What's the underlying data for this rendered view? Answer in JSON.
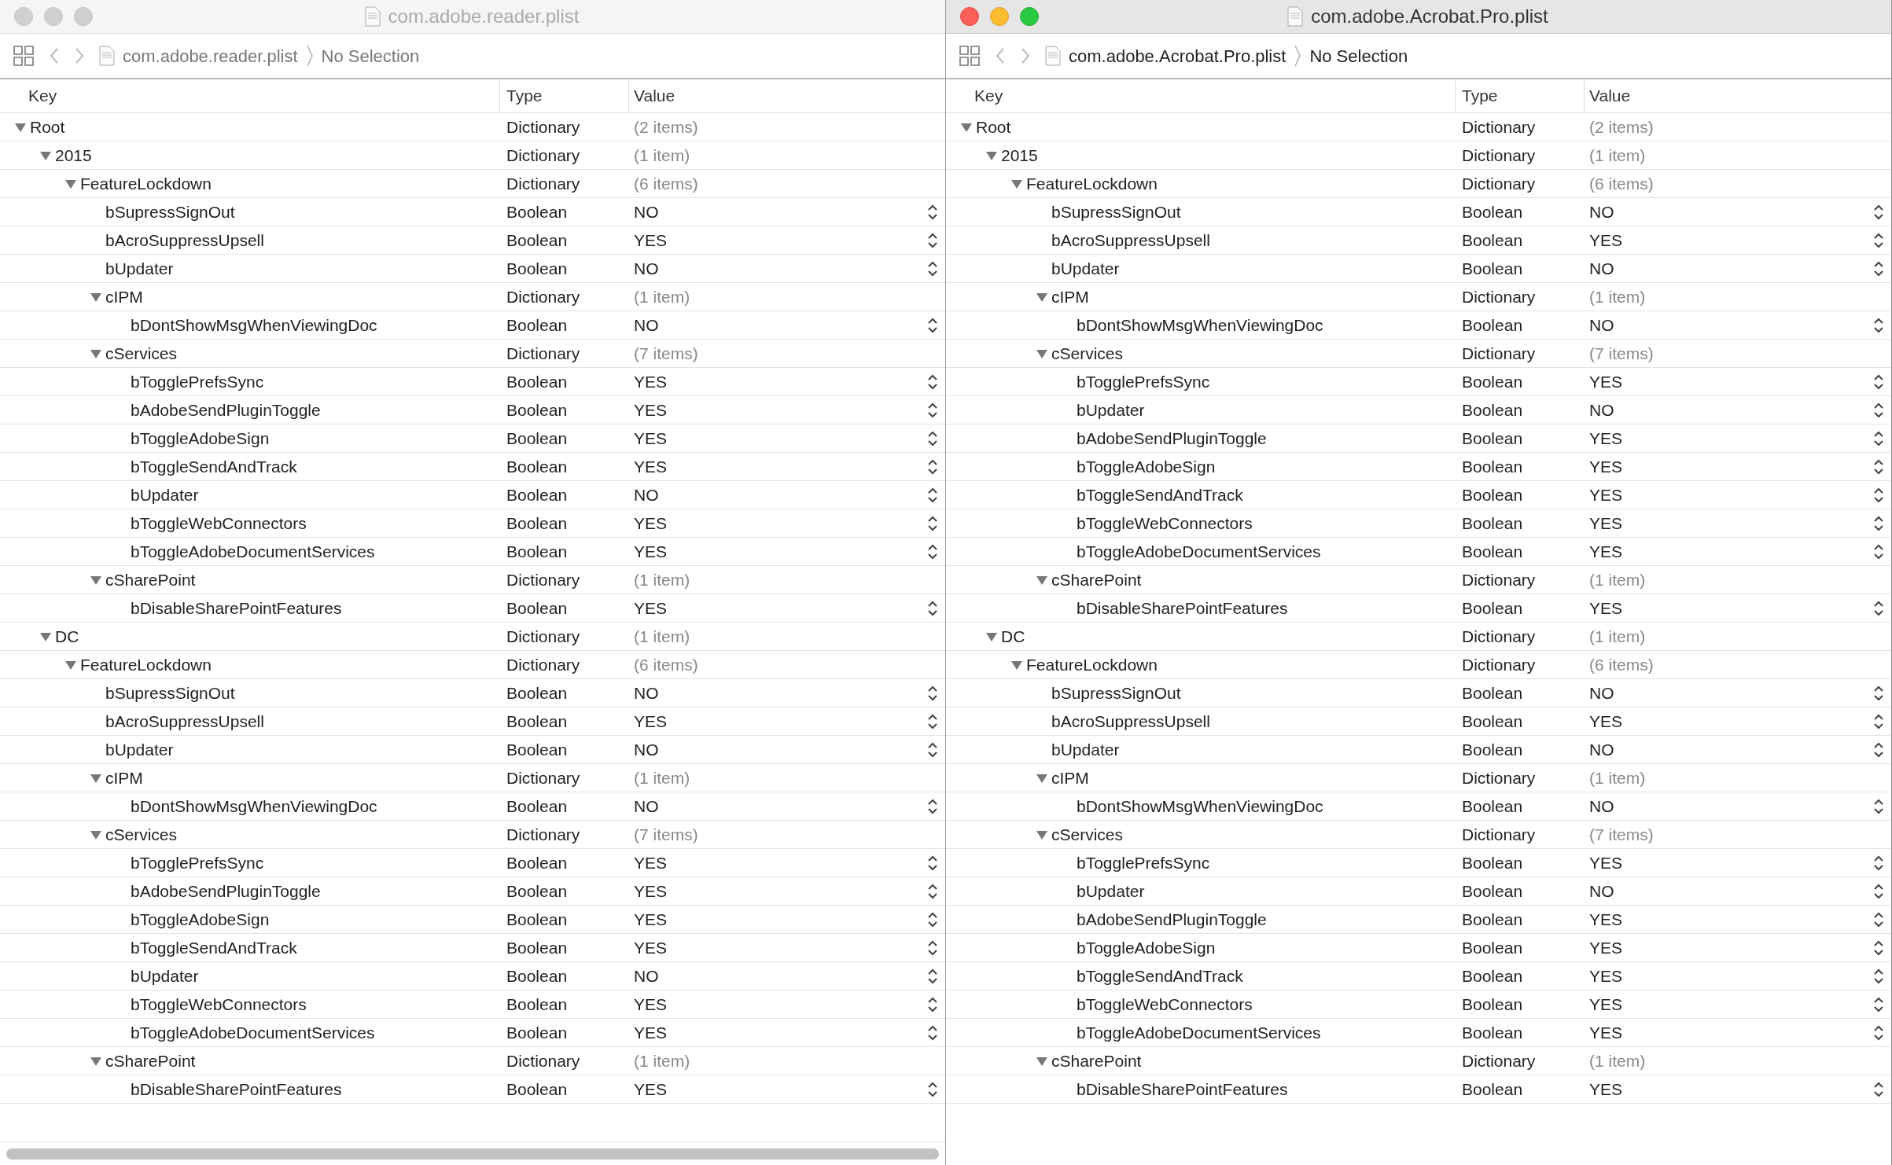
{
  "windows": [
    {
      "title": "com.adobe.reader.plist",
      "active": false,
      "breadcrumb": {
        "file": "com.adobe.reader.plist",
        "selection": "No Selection"
      },
      "columns": [
        "Key",
        "Type",
        "Value"
      ],
      "rows": [
        {
          "key": "Root",
          "type": "Dictionary",
          "value": "(2 items)",
          "kind": "dictionary",
          "expanded": true,
          "children": [
            {
              "key": "2015",
              "type": "Dictionary",
              "value": "(1 item)",
              "kind": "dictionary",
              "expanded": true,
              "children": [
                {
                  "key": "FeatureLockdown",
                  "type": "Dictionary",
                  "value": "(6 items)",
                  "kind": "dictionary",
                  "expanded": true,
                  "children": [
                    {
                      "key": "bSupressSignOut",
                      "type": "Boolean",
                      "value": "NO",
                      "kind": "boolean"
                    },
                    {
                      "key": "bAcroSuppressUpsell",
                      "type": "Boolean",
                      "value": "YES",
                      "kind": "boolean"
                    },
                    {
                      "key": "bUpdater",
                      "type": "Boolean",
                      "value": "NO",
                      "kind": "boolean"
                    },
                    {
                      "key": "cIPM",
                      "type": "Dictionary",
                      "value": "(1 item)",
                      "kind": "dictionary",
                      "expanded": true,
                      "children": [
                        {
                          "key": "bDontShowMsgWhenViewingDoc",
                          "type": "Boolean",
                          "value": "NO",
                          "kind": "boolean"
                        }
                      ]
                    },
                    {
                      "key": "cServices",
                      "type": "Dictionary",
                      "value": "(7 items)",
                      "kind": "dictionary",
                      "expanded": true,
                      "children": [
                        {
                          "key": "bTogglePrefsSync",
                          "type": "Boolean",
                          "value": "YES",
                          "kind": "boolean"
                        },
                        {
                          "key": "bAdobeSendPluginToggle",
                          "type": "Boolean",
                          "value": "YES",
                          "kind": "boolean"
                        },
                        {
                          "key": "bToggleAdobeSign",
                          "type": "Boolean",
                          "value": "YES",
                          "kind": "boolean"
                        },
                        {
                          "key": "bToggleSendAndTrack",
                          "type": "Boolean",
                          "value": "YES",
                          "kind": "boolean"
                        },
                        {
                          "key": "bUpdater",
                          "type": "Boolean",
                          "value": "NO",
                          "kind": "boolean"
                        },
                        {
                          "key": "bToggleWebConnectors",
                          "type": "Boolean",
                          "value": "YES",
                          "kind": "boolean"
                        },
                        {
                          "key": "bToggleAdobeDocumentServices",
                          "type": "Boolean",
                          "value": "YES",
                          "kind": "boolean"
                        }
                      ]
                    },
                    {
                      "key": "cSharePoint",
                      "type": "Dictionary",
                      "value": "(1 item)",
                      "kind": "dictionary",
                      "expanded": true,
                      "children": [
                        {
                          "key": "bDisableSharePointFeatures",
                          "type": "Boolean",
                          "value": "YES",
                          "kind": "boolean"
                        }
                      ]
                    }
                  ]
                }
              ]
            },
            {
              "key": "DC",
              "type": "Dictionary",
              "value": "(1 item)",
              "kind": "dictionary",
              "expanded": true,
              "children": [
                {
                  "key": "FeatureLockdown",
                  "type": "Dictionary",
                  "value": "(6 items)",
                  "kind": "dictionary",
                  "expanded": true,
                  "children": [
                    {
                      "key": "bSupressSignOut",
                      "type": "Boolean",
                      "value": "NO",
                      "kind": "boolean"
                    },
                    {
                      "key": "bAcroSuppressUpsell",
                      "type": "Boolean",
                      "value": "YES",
                      "kind": "boolean"
                    },
                    {
                      "key": "bUpdater",
                      "type": "Boolean",
                      "value": "NO",
                      "kind": "boolean"
                    },
                    {
                      "key": "cIPM",
                      "type": "Dictionary",
                      "value": "(1 item)",
                      "kind": "dictionary",
                      "expanded": true,
                      "children": [
                        {
                          "key": "bDontShowMsgWhenViewingDoc",
                          "type": "Boolean",
                          "value": "NO",
                          "kind": "boolean"
                        }
                      ]
                    },
                    {
                      "key": "cServices",
                      "type": "Dictionary",
                      "value": "(7 items)",
                      "kind": "dictionary",
                      "expanded": true,
                      "children": [
                        {
                          "key": "bTogglePrefsSync",
                          "type": "Boolean",
                          "value": "YES",
                          "kind": "boolean"
                        },
                        {
                          "key": "bAdobeSendPluginToggle",
                          "type": "Boolean",
                          "value": "YES",
                          "kind": "boolean"
                        },
                        {
                          "key": "bToggleAdobeSign",
                          "type": "Boolean",
                          "value": "YES",
                          "kind": "boolean"
                        },
                        {
                          "key": "bToggleSendAndTrack",
                          "type": "Boolean",
                          "value": "YES",
                          "kind": "boolean"
                        },
                        {
                          "key": "bUpdater",
                          "type": "Boolean",
                          "value": "NO",
                          "kind": "boolean"
                        },
                        {
                          "key": "bToggleWebConnectors",
                          "type": "Boolean",
                          "value": "YES",
                          "kind": "boolean"
                        },
                        {
                          "key": "bToggleAdobeDocumentServices",
                          "type": "Boolean",
                          "value": "YES",
                          "kind": "boolean"
                        }
                      ]
                    },
                    {
                      "key": "cSharePoint",
                      "type": "Dictionary",
                      "value": "(1 item)",
                      "kind": "dictionary",
                      "expanded": true,
                      "children": [
                        {
                          "key": "bDisableSharePointFeatures",
                          "type": "Boolean",
                          "value": "YES",
                          "kind": "boolean"
                        }
                      ]
                    }
                  ]
                }
              ]
            }
          ]
        }
      ]
    },
    {
      "title": "com.adobe.Acrobat.Pro.plist",
      "active": true,
      "breadcrumb": {
        "file": "com.adobe.Acrobat.Pro.plist",
        "selection": "No Selection"
      },
      "columns": [
        "Key",
        "Type",
        "Value"
      ],
      "rows": [
        {
          "key": "Root",
          "type": "Dictionary",
          "value": "(2 items)",
          "kind": "dictionary",
          "expanded": true,
          "children": [
            {
              "key": "2015",
              "type": "Dictionary",
              "value": "(1 item)",
              "kind": "dictionary",
              "expanded": true,
              "children": [
                {
                  "key": "FeatureLockdown",
                  "type": "Dictionary",
                  "value": "(6 items)",
                  "kind": "dictionary",
                  "expanded": true,
                  "children": [
                    {
                      "key": "bSupressSignOut",
                      "type": "Boolean",
                      "value": "NO",
                      "kind": "boolean"
                    },
                    {
                      "key": "bAcroSuppressUpsell",
                      "type": "Boolean",
                      "value": "YES",
                      "kind": "boolean"
                    },
                    {
                      "key": "bUpdater",
                      "type": "Boolean",
                      "value": "NO",
                      "kind": "boolean"
                    },
                    {
                      "key": "cIPM",
                      "type": "Dictionary",
                      "value": "(1 item)",
                      "kind": "dictionary",
                      "expanded": true,
                      "children": [
                        {
                          "key": "bDontShowMsgWhenViewingDoc",
                          "type": "Boolean",
                          "value": "NO",
                          "kind": "boolean"
                        }
                      ]
                    },
                    {
                      "key": "cServices",
                      "type": "Dictionary",
                      "value": "(7 items)",
                      "kind": "dictionary",
                      "expanded": true,
                      "children": [
                        {
                          "key": "bTogglePrefsSync",
                          "type": "Boolean",
                          "value": "YES",
                          "kind": "boolean"
                        },
                        {
                          "key": "bUpdater",
                          "type": "Boolean",
                          "value": "NO",
                          "kind": "boolean"
                        },
                        {
                          "key": "bAdobeSendPluginToggle",
                          "type": "Boolean",
                          "value": "YES",
                          "kind": "boolean"
                        },
                        {
                          "key": "bToggleAdobeSign",
                          "type": "Boolean",
                          "value": "YES",
                          "kind": "boolean"
                        },
                        {
                          "key": "bToggleSendAndTrack",
                          "type": "Boolean",
                          "value": "YES",
                          "kind": "boolean"
                        },
                        {
                          "key": "bToggleWebConnectors",
                          "type": "Boolean",
                          "value": "YES",
                          "kind": "boolean"
                        },
                        {
                          "key": "bToggleAdobeDocumentServices",
                          "type": "Boolean",
                          "value": "YES",
                          "kind": "boolean"
                        }
                      ]
                    },
                    {
                      "key": "cSharePoint",
                      "type": "Dictionary",
                      "value": "(1 item)",
                      "kind": "dictionary",
                      "expanded": true,
                      "children": [
                        {
                          "key": "bDisableSharePointFeatures",
                          "type": "Boolean",
                          "value": "YES",
                          "kind": "boolean"
                        }
                      ]
                    }
                  ]
                }
              ]
            },
            {
              "key": "DC",
              "type": "Dictionary",
              "value": "(1 item)",
              "kind": "dictionary",
              "expanded": true,
              "children": [
                {
                  "key": "FeatureLockdown",
                  "type": "Dictionary",
                  "value": "(6 items)",
                  "kind": "dictionary",
                  "expanded": true,
                  "children": [
                    {
                      "key": "bSupressSignOut",
                      "type": "Boolean",
                      "value": "NO",
                      "kind": "boolean"
                    },
                    {
                      "key": "bAcroSuppressUpsell",
                      "type": "Boolean",
                      "value": "YES",
                      "kind": "boolean"
                    },
                    {
                      "key": "bUpdater",
                      "type": "Boolean",
                      "value": "NO",
                      "kind": "boolean"
                    },
                    {
                      "key": "cIPM",
                      "type": "Dictionary",
                      "value": "(1 item)",
                      "kind": "dictionary",
                      "expanded": true,
                      "children": [
                        {
                          "key": "bDontShowMsgWhenViewingDoc",
                          "type": "Boolean",
                          "value": "NO",
                          "kind": "boolean"
                        }
                      ]
                    },
                    {
                      "key": "cServices",
                      "type": "Dictionary",
                      "value": "(7 items)",
                      "kind": "dictionary",
                      "expanded": true,
                      "children": [
                        {
                          "key": "bTogglePrefsSync",
                          "type": "Boolean",
                          "value": "YES",
                          "kind": "boolean"
                        },
                        {
                          "key": "bUpdater",
                          "type": "Boolean",
                          "value": "NO",
                          "kind": "boolean"
                        },
                        {
                          "key": "bAdobeSendPluginToggle",
                          "type": "Boolean",
                          "value": "YES",
                          "kind": "boolean"
                        },
                        {
                          "key": "bToggleAdobeSign",
                          "type": "Boolean",
                          "value": "YES",
                          "kind": "boolean"
                        },
                        {
                          "key": "bToggleSendAndTrack",
                          "type": "Boolean",
                          "value": "YES",
                          "kind": "boolean"
                        },
                        {
                          "key": "bToggleWebConnectors",
                          "type": "Boolean",
                          "value": "YES",
                          "kind": "boolean"
                        },
                        {
                          "key": "bToggleAdobeDocumentServices",
                          "type": "Boolean",
                          "value": "YES",
                          "kind": "boolean"
                        }
                      ]
                    },
                    {
                      "key": "cSharePoint",
                      "type": "Dictionary",
                      "value": "(1 item)",
                      "kind": "dictionary",
                      "expanded": true,
                      "children": [
                        {
                          "key": "bDisableSharePointFeatures",
                          "type": "Boolean",
                          "value": "YES",
                          "kind": "boolean"
                        }
                      ]
                    }
                  ]
                }
              ]
            }
          ]
        }
      ]
    }
  ]
}
